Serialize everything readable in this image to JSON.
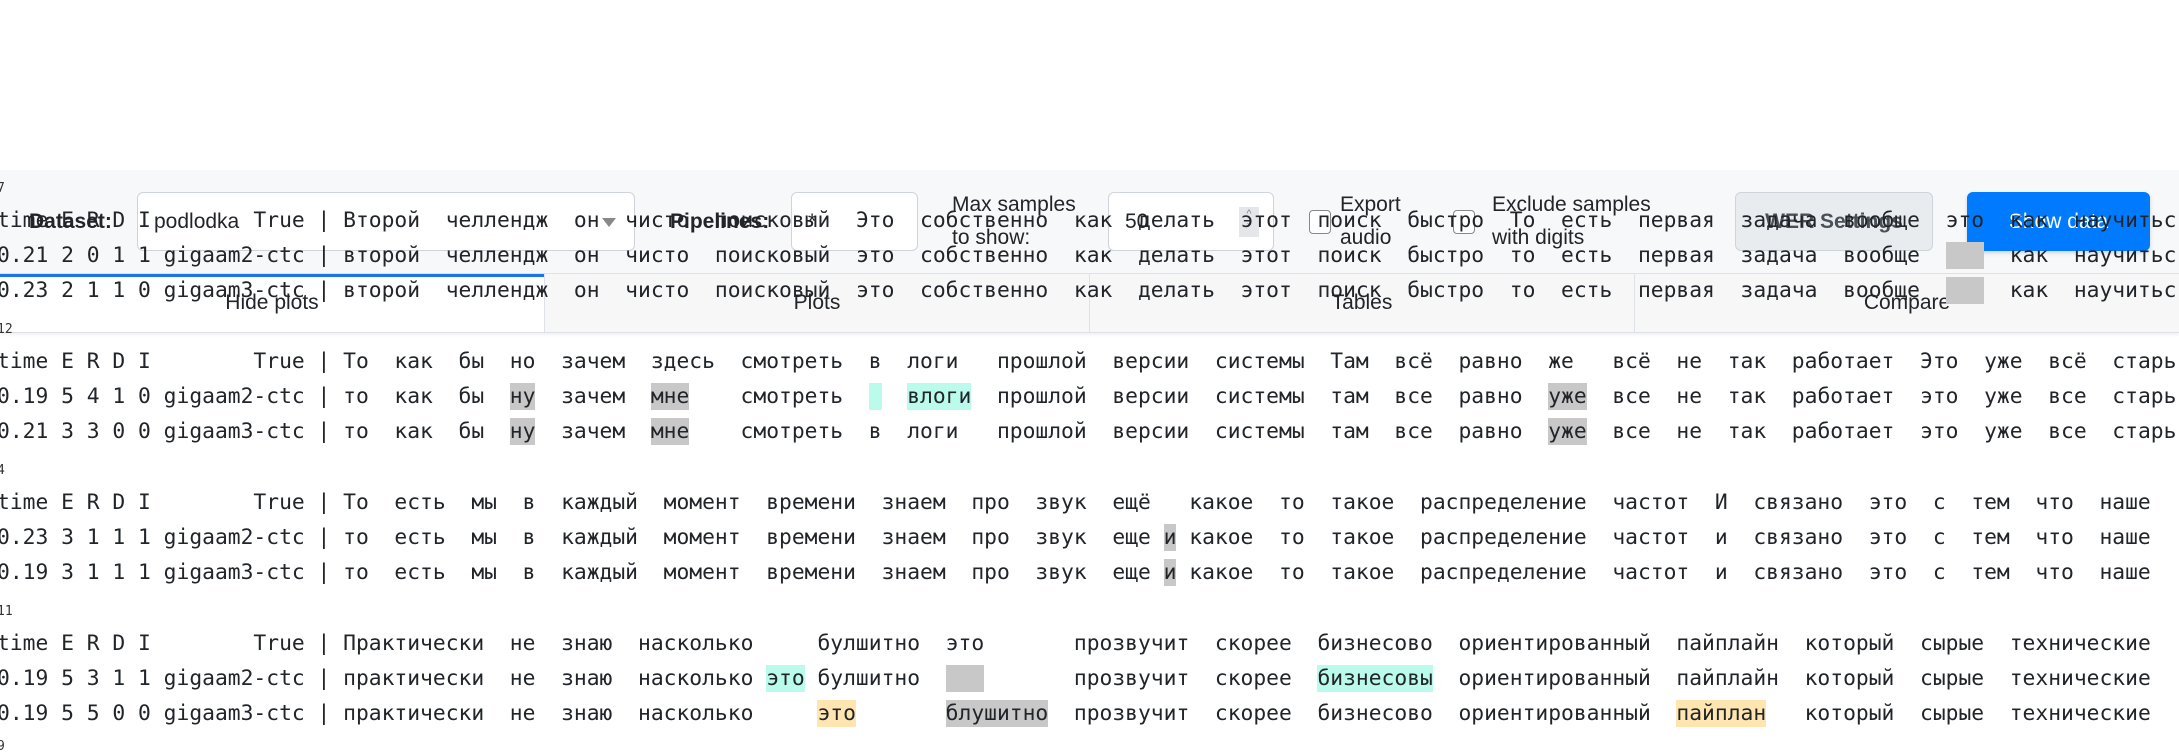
{
  "toolbar": {
    "dataset_label": "Dataset:",
    "dataset_value": "podlodka",
    "pipelines_label": "Pipelines:",
    "pipelines_value": "*",
    "max_samples_label_1": "Max samples",
    "max_samples_label_2": "to show:",
    "max_samples_value": "50",
    "export_audio_label_1": "Export",
    "export_audio_label_2": "audio",
    "export_audio_checked": false,
    "exclude_digits_label_1": "Exclude samples",
    "exclude_digits_label_2": "with digits",
    "exclude_digits_checked": false,
    "wer_settings_label": "WER Settings",
    "show_data_label": "Show data"
  },
  "tabs": [
    {
      "label": "Hide plots",
      "active": true
    },
    {
      "label": "Plots",
      "active": false
    },
    {
      "label": "Tables",
      "active": false
    },
    {
      "label": "Compare",
      "active": false
    }
  ],
  "colors": {
    "gray": "#c8c8c8",
    "cyan": "#bbfbeb",
    "orange": "#ffe6b0",
    "accent": "#007bff"
  },
  "header_prefix": "time E R D I        True",
  "blocks": [
    {
      "index": "7",
      "rows": [
        {
          "prefix": "time E R D I        True"
        },
        {
          "prefix": "0.21 2 0 1 1 gigaam2-ctc"
        },
        {
          "prefix": "0.23 2 1 1 0 gigaam3-ctc"
        }
      ],
      "columns": [
        [
          [
            "Второй"
          ],
          [
            "второй"
          ],
          [
            "второй"
          ]
        ],
        [
          [
            "челлендж"
          ],
          [
            "челлендж"
          ],
          [
            "челлендж"
          ]
        ],
        [
          [
            "он"
          ],
          [
            "он"
          ],
          [
            "он"
          ]
        ],
        [
          [
            "чисто"
          ],
          [
            "чисто"
          ],
          [
            "чисто"
          ]
        ],
        [
          [
            "поисковый"
          ],
          [
            "поисковый"
          ],
          [
            "поисковый"
          ]
        ],
        [
          [
            "Это"
          ],
          [
            "это"
          ],
          [
            "это"
          ]
        ],
        [
          [
            "собственно"
          ],
          [
            "собственно"
          ],
          [
            "собственно"
          ]
        ],
        [
          [
            "как"
          ],
          [
            "как"
          ],
          [
            "как"
          ]
        ],
        [
          [
            "делать"
          ],
          [
            "делать"
          ],
          [
            "делать"
          ]
        ],
        [
          [
            "этот"
          ],
          [
            "этот"
          ],
          [
            "этот"
          ]
        ],
        [
          [
            "поиск"
          ],
          [
            "поиск"
          ],
          [
            "поиск"
          ]
        ],
        [
          [
            "быстро"
          ],
          [
            "быстро"
          ],
          [
            "быстро"
          ]
        ],
        [
          [
            "То"
          ],
          [
            "то"
          ],
          [
            "то"
          ]
        ],
        [
          [
            "есть"
          ],
          [
            "есть"
          ],
          [
            "есть"
          ]
        ],
        [
          [
            "первая"
          ],
          [
            "первая"
          ],
          [
            "первая"
          ]
        ],
        [
          [
            "задача"
          ],
          [
            "задача"
          ],
          [
            "задача"
          ]
        ],
        [
          [
            "вообще"
          ],
          [
            "вообще"
          ],
          [
            "вообще"
          ]
        ],
        [
          [
            "это"
          ],
          [
            "",
            "gray"
          ],
          [
            "",
            "gray"
          ]
        ],
        [
          [
            "как"
          ],
          [
            "как"
          ],
          [
            "как"
          ]
        ],
        [
          [
            "научитьс"
          ],
          [
            "научитьс"
          ],
          [
            "научитьс"
          ]
        ]
      ]
    },
    {
      "index": "12",
      "rows": [
        {
          "prefix": "time E R D I        True"
        },
        {
          "prefix": "0.19 5 4 1 0 gigaam2-ctc"
        },
        {
          "prefix": "0.21 3 3 0 0 gigaam3-ctc"
        }
      ],
      "columns": [
        [
          [
            "То"
          ],
          [
            "то"
          ],
          [
            "то"
          ]
        ],
        [
          [
            "как"
          ],
          [
            "как"
          ],
          [
            "как"
          ]
        ],
        [
          [
            "бы"
          ],
          [
            "бы"
          ],
          [
            "бы"
          ]
        ],
        [
          [
            "но"
          ],
          [
            "ну",
            "gray"
          ],
          [
            "ну",
            "gray"
          ]
        ],
        [
          [
            "зачем"
          ],
          [
            "зачем"
          ],
          [
            "зачем"
          ]
        ],
        [
          [
            "здесь"
          ],
          [
            "мне",
            "gray"
          ],
          [
            "мне",
            "gray"
          ]
        ],
        [
          [
            "смотреть"
          ],
          [
            "смотреть"
          ],
          [
            "смотреть"
          ]
        ],
        [
          [
            "в"
          ],
          [
            "",
            "cyan"
          ],
          [
            "в"
          ]
        ],
        [
          [
            "логи"
          ],
          [
            "влоги",
            "cyan"
          ],
          [
            "логи"
          ]
        ],
        [
          [
            "прошлой"
          ],
          [
            "прошлой"
          ],
          [
            "прошлой"
          ]
        ],
        [
          [
            "версии"
          ],
          [
            "версии"
          ],
          [
            "версии"
          ]
        ],
        [
          [
            "системы"
          ],
          [
            "системы"
          ],
          [
            "системы"
          ]
        ],
        [
          [
            "Там"
          ],
          [
            "там"
          ],
          [
            "там"
          ]
        ],
        [
          [
            "всё"
          ],
          [
            "все"
          ],
          [
            "все"
          ]
        ],
        [
          [
            "равно"
          ],
          [
            "равно"
          ],
          [
            "равно"
          ]
        ],
        [
          [
            "же"
          ],
          [
            "уже",
            "gray"
          ],
          [
            "уже",
            "gray"
          ]
        ],
        [
          [
            "всё"
          ],
          [
            "все"
          ],
          [
            "все"
          ]
        ],
        [
          [
            "не"
          ],
          [
            "не"
          ],
          [
            "не"
          ]
        ],
        [
          [
            "так"
          ],
          [
            "так"
          ],
          [
            "так"
          ]
        ],
        [
          [
            "работает"
          ],
          [
            "работает"
          ],
          [
            "работает"
          ]
        ],
        [
          [
            "Это"
          ],
          [
            "это"
          ],
          [
            "это"
          ]
        ],
        [
          [
            "уже"
          ],
          [
            "уже"
          ],
          [
            "уже"
          ]
        ],
        [
          [
            "всё"
          ],
          [
            "все"
          ],
          [
            "все"
          ]
        ],
        [
          [
            "старь"
          ],
          [
            "старь"
          ],
          [
            "старь"
          ]
        ]
      ]
    },
    {
      "index": "4",
      "rows": [
        {
          "prefix": "time E R D I        True"
        },
        {
          "prefix": "0.23 3 1 1 1 gigaam2-ctc"
        },
        {
          "prefix": "0.19 3 1 1 1 gigaam3-ctc"
        }
      ],
      "columns": [
        [
          [
            "То"
          ],
          [
            "то"
          ],
          [
            "то"
          ]
        ],
        [
          [
            "есть"
          ],
          [
            "есть"
          ],
          [
            "есть"
          ]
        ],
        [
          [
            "мы"
          ],
          [
            "мы"
          ],
          [
            "мы"
          ]
        ],
        [
          [
            "в"
          ],
          [
            "в"
          ],
          [
            "в"
          ]
        ],
        [
          [
            "каждый"
          ],
          [
            "каждый"
          ],
          [
            "каждый"
          ]
        ],
        [
          [
            "момент"
          ],
          [
            "момент"
          ],
          [
            "момент"
          ]
        ],
        [
          [
            "времени"
          ],
          [
            "времени"
          ],
          [
            "времени"
          ]
        ],
        [
          [
            "знаем"
          ],
          [
            "знаем"
          ],
          [
            "знаем"
          ]
        ],
        [
          [
            "про"
          ],
          [
            "про"
          ],
          [
            "про"
          ]
        ],
        [
          [
            "звук"
          ],
          [
            "звук"
          ],
          [
            "звук"
          ]
        ],
        [
          [
            "ещё"
          ],
          [
            "еще"
          ],
          [
            "еще"
          ]
        ],
        [
          [
            ""
          ],
          [
            "и",
            "gray"
          ],
          [
            "и",
            "gray"
          ]
        ],
        [
          [
            "какое"
          ],
          [
            "какое"
          ],
          [
            "какое"
          ]
        ],
        [
          [
            "то"
          ],
          [
            "то"
          ],
          [
            "то"
          ]
        ],
        [
          [
            "такое"
          ],
          [
            "такое"
          ],
          [
            "такое"
          ]
        ],
        [
          [
            "распределение"
          ],
          [
            "распределение"
          ],
          [
            "распределение"
          ]
        ],
        [
          [
            "частот"
          ],
          [
            "частот"
          ],
          [
            "частот"
          ]
        ],
        [
          [
            "И"
          ],
          [
            "и"
          ],
          [
            "и"
          ]
        ],
        [
          [
            "связано"
          ],
          [
            "связано"
          ],
          [
            "связано"
          ]
        ],
        [
          [
            "это"
          ],
          [
            "это"
          ],
          [
            "это"
          ]
        ],
        [
          [
            "с"
          ],
          [
            "с"
          ],
          [
            "с"
          ]
        ],
        [
          [
            "тем"
          ],
          [
            "тем"
          ],
          [
            "тем"
          ]
        ],
        [
          [
            "что"
          ],
          [
            "что"
          ],
          [
            "что"
          ]
        ],
        [
          [
            "наше"
          ],
          [
            "наше"
          ],
          [
            "наше"
          ]
        ]
      ]
    },
    {
      "index": "11",
      "rows": [
        {
          "prefix": "time E R D I        True"
        },
        {
          "prefix": "0.19 5 3 1 1 gigaam2-ctc"
        },
        {
          "prefix": "0.19 5 5 0 0 gigaam3-ctc"
        }
      ],
      "columns": [
        [
          [
            "Практически"
          ],
          [
            "практически"
          ],
          [
            "практически"
          ]
        ],
        [
          [
            "не"
          ],
          [
            "не"
          ],
          [
            "не"
          ]
        ],
        [
          [
            "знаю"
          ],
          [
            "знаю"
          ],
          [
            "знаю"
          ]
        ],
        [
          [
            "насколько"
          ],
          [
            "насколько"
          ],
          [
            "насколько"
          ]
        ],
        [
          [
            ""
          ],
          [
            "это",
            "cyan"
          ],
          [
            ""
          ]
        ],
        [
          [
            "булшитно"
          ],
          [
            "булшитно"
          ],
          [
            "это",
            "orange"
          ]
        ],
        [
          [
            "это"
          ],
          [
            "",
            "gray"
          ],
          [
            "блушитно",
            "gray"
          ]
        ],
        [
          [
            "прозвучит"
          ],
          [
            "прозвучит"
          ],
          [
            "прозвучит"
          ]
        ],
        [
          [
            "скорее"
          ],
          [
            "скорее"
          ],
          [
            "скорее"
          ]
        ],
        [
          [
            "бизнесово"
          ],
          [
            "бизнесовы",
            "cyan"
          ],
          [
            "бизнесово"
          ]
        ],
        [
          [
            "ориентированный"
          ],
          [
            "ориентированный"
          ],
          [
            "ориентированный"
          ]
        ],
        [
          [
            "пайплайн"
          ],
          [
            "пайплайн"
          ],
          [
            "пайплан",
            "orange"
          ]
        ],
        [
          [
            "который"
          ],
          [
            "который"
          ],
          [
            "который"
          ]
        ],
        [
          [
            "сырые"
          ],
          [
            "сырые"
          ],
          [
            "сырые"
          ]
        ],
        [
          [
            "технические"
          ],
          [
            "технические"
          ],
          [
            "технические"
          ]
        ]
      ]
    },
    {
      "index": "9",
      "rows": [],
      "columns": []
    }
  ]
}
